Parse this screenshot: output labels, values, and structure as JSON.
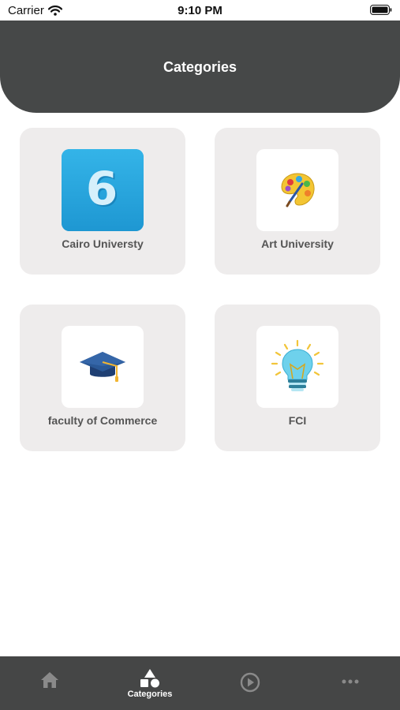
{
  "status_bar": {
    "carrier": "Carrier",
    "time": "9:10 PM"
  },
  "header": {
    "title": "Categories"
  },
  "categories": [
    {
      "label": "Cairo Universty",
      "icon": "number-six-icon"
    },
    {
      "label": "Art University",
      "icon": "paint-palette-icon"
    },
    {
      "label": "faculty of Commerce",
      "icon": "graduation-cap-icon"
    },
    {
      "label": "FCI",
      "icon": "lightbulb-icon"
    }
  ],
  "tabbar": {
    "active_color": "#ffffff",
    "inactive_color": "#8a8a8a",
    "tabs": [
      {
        "icon": "home-icon",
        "label": ""
      },
      {
        "icon": "shapes-icon",
        "label": "Categories"
      },
      {
        "icon": "play-circle-icon",
        "label": ""
      },
      {
        "icon": "more-icon",
        "label": ""
      }
    ]
  },
  "colors": {
    "header_bg": "#464848",
    "card_bg": "#eeecec",
    "tabbar_bg": "#454646"
  }
}
